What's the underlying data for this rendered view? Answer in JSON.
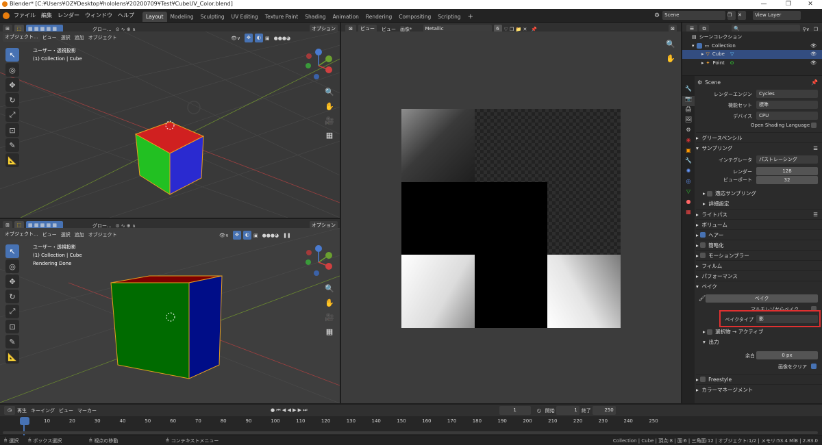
{
  "window": {
    "title": "Blender* [C:¥Users¥OZ¥Desktop¥hololens¥20200709¥Test¥CubeUV_Color.blend]",
    "min": "—",
    "max": "❐",
    "close": "✕"
  },
  "menu": [
    "ファイル",
    "編集",
    "レンダー",
    "ウィンドウ",
    "ヘルプ"
  ],
  "workspaces": [
    "Layout",
    "Modeling",
    "Sculpting",
    "UV Editing",
    "Texture Paint",
    "Shading",
    "Animation",
    "Rendering",
    "Compositing",
    "Scripting"
  ],
  "active_workspace": "Layout",
  "add_tab": "+",
  "scene": {
    "label": "Scene",
    "view_layer": "View Layer"
  },
  "viewport_top": {
    "row1": {
      "transform": "グロー...",
      "options": "オプション"
    },
    "row2": {
      "mode": "オブジェクト...",
      "view": "ビュー",
      "select": "選択",
      "add": "追加",
      "object": "オブジェクト"
    },
    "overlay_lines": [
      "ユーザー・透視投影",
      "(1) Collection | Cube"
    ]
  },
  "viewport_bottom": {
    "row1": {
      "transform": "グロー...",
      "options": "オプション"
    },
    "row2": {
      "mode": "オブジェクト...",
      "view": "ビュー",
      "select": "選択",
      "add": "追加",
      "object": "オブジェクト"
    },
    "overlay_lines": [
      "ユーザー・透視投影",
      "(1) Collection | Cube",
      "Rendering Done"
    ]
  },
  "image_editor": {
    "view": "ビュー",
    "view2": "ビュー",
    "image": "画像*",
    "image_name": "Metallic",
    "users": "6"
  },
  "outliner": {
    "search_placeholder": "",
    "rows": [
      {
        "label": "シーンコレクション"
      },
      {
        "label": "Collection"
      },
      {
        "label": "Cube"
      },
      {
        "label": "Point"
      }
    ]
  },
  "properties": {
    "header": "Scene",
    "render_engine_label": "レンダーエンジン",
    "render_engine": "Cycles",
    "feature_set_label": "機能セット",
    "feature_set": "標準",
    "device_label": "デバイス",
    "device": "CPU",
    "osl": "Open Shading Language",
    "grease_pencil": "グリースペンシル",
    "sampling": "サンプリング",
    "integrator_label": "インテグレータ",
    "integrator": "パストレーシング",
    "render_label": "レンダー",
    "render_samples": "128",
    "viewport_label": "ビューポート",
    "viewport_samples": "32",
    "adaptive": "適応サンプリング",
    "advanced": "詳細設定",
    "light_paths": "ライトパス",
    "volumes": "ボリューム",
    "hair": "ヘアー",
    "simplify": "簡略化",
    "motion_blur": "モーションブラー",
    "film": "フィルム",
    "performance": "パフォーマンス",
    "bake": "ベイク",
    "bake_button": "ベイク",
    "multires": "マルチレゾからベイク",
    "bake_type_label": "ベイクタイプ",
    "bake_type": "影",
    "selected_to_active": "選択物 → アクティブ",
    "output": "出力",
    "margin_label": "余白",
    "margin": "0 px",
    "clear_image": "画像をクリア",
    "freestyle": "Freestyle",
    "color_management": "カラーマネージメント"
  },
  "timeline": {
    "playback": "再生",
    "keying": "キーイング",
    "view": "ビュー",
    "marker": "マーカー",
    "current": "1",
    "start_label": "開始",
    "start": "1",
    "end_label": "終了",
    "end": "250",
    "ticks": [
      "1",
      "10",
      "20",
      "30",
      "40",
      "50",
      "60",
      "70",
      "80",
      "90",
      "100",
      "110",
      "120",
      "130",
      "140",
      "150",
      "160",
      "170",
      "180",
      "190",
      "200",
      "210",
      "220",
      "230",
      "240",
      "250"
    ]
  },
  "status": {
    "select": "選択",
    "box_select": "ボックス選択",
    "rotate_view": "視点の移動",
    "context_menu": "コンテキストメニュー",
    "info": "Collection | Cube | 頂点:8 | 面:6 | 三角面:12 | オブジェクト:1/2 | メモリ:53.4 MiB | 2.83.0"
  },
  "colors": {
    "accent": "#4772b3",
    "highlight": "#e03030",
    "selected_row": "#334d80"
  }
}
